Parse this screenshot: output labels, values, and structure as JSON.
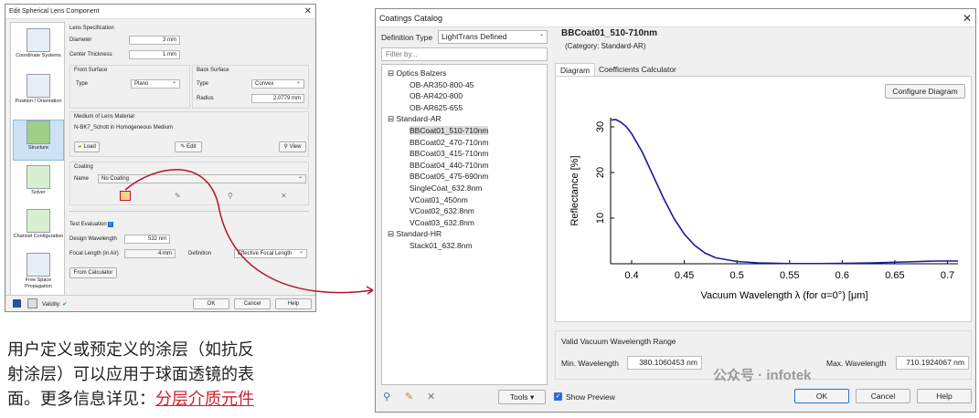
{
  "dialog": {
    "title": "Edit Spherical Lens Component",
    "sidebar": [
      "Coordinate Systems",
      "Position / Orientation",
      "Structure",
      "Solver",
      "Channel Configuration",
      "Free Space Propagation"
    ],
    "lens_spec": {
      "title": "Lens Specification",
      "diameter_label": "Diameter",
      "diameter": "3 mm",
      "thickness_label": "Center Thickness",
      "thickness": "1 mm"
    },
    "front": {
      "title": "Front Surface",
      "type_label": "Type",
      "type": "Plano"
    },
    "back": {
      "title": "Back Surface",
      "type_label": "Type",
      "type": "Convex",
      "radius_label": "Radius",
      "radius": "2.0779 mm"
    },
    "medium": {
      "title": "Medium of Lens Material",
      "value": "N-BK7_Schott in Homogeneous Medium",
      "load": "Load",
      "edit": "Edit",
      "view": "View"
    },
    "coating": {
      "title": "Coating",
      "name_label": "Name",
      "name": "No Coating"
    },
    "test": {
      "title": "Test Evaluation",
      "wl_label": "Design Wavelength",
      "wl": "532 nm",
      "fl_label": "Focal Length (in Air)",
      "fl": "4 mm",
      "def_label": "Definition",
      "def": "Effective Focal Length",
      "from_calc": "From Calculator"
    },
    "validity": "Validity:",
    "ok": "OK",
    "cancel": "Cancel",
    "help": "Help"
  },
  "caption": {
    "line1": "用户定义或预定义的涂层（如抗反",
    "line2": "射涂层）可以应用于球面透镜的表",
    "line3_prefix": "面。更多信息详见：",
    "line3_link": "分层介质元件"
  },
  "catalog": {
    "title": "Coatings Catalog",
    "def_type_label": "Definition Type",
    "def_type": "LightTrans Defined",
    "filter_placeholder": "Filter by...",
    "tree": [
      {
        "label": "Optics Balzers",
        "group": true
      },
      {
        "label": "OB-AR350-800-45"
      },
      {
        "label": "OB-AR420-800"
      },
      {
        "label": "OB-AR625-655"
      },
      {
        "label": "Standard-AR",
        "group": true
      },
      {
        "label": "BBCoat01_510-710nm",
        "selected": true
      },
      {
        "label": "BBCoat02_470-710nm"
      },
      {
        "label": "BBCoat03_415-710nm"
      },
      {
        "label": "BBCoat04_440-710nm"
      },
      {
        "label": "BBCoat05_475-690nm"
      },
      {
        "label": "SingleCoat_632.8nm"
      },
      {
        "label": "VCoat01_450nm"
      },
      {
        "label": "VCoat02_632.8nm"
      },
      {
        "label": "VCoat03_632.8nm"
      },
      {
        "label": "Standard-HR",
        "group": true
      },
      {
        "label": "Stack01_632.8nm"
      }
    ],
    "selected_name": "BBCoat01_510-710nm",
    "category": "(Category: Standard-AR)",
    "tabs": [
      "Diagram",
      "Coefficients Calculator"
    ],
    "configure": "Configure Diagram",
    "range_title": "Valid Vacuum Wavelength Range",
    "min_label": "Min. Wavelength",
    "min": "380.1060453 nm",
    "max_label": "Max. Wavelength",
    "max": "710.1924067 nm",
    "tools": "Tools",
    "show_preview": "Show Preview",
    "ok": "OK",
    "cancel": "Cancel",
    "help": "Help"
  },
  "watermark": "公众号 · infotek",
  "chart_data": {
    "type": "line",
    "xlabel": "Vacuum Wavelength λ (for α=0°) [μm]",
    "ylabel": "Reflectance [%]",
    "xlim": [
      0.38,
      0.71
    ],
    "ylim": [
      0,
      32
    ],
    "xticks": [
      "0.4",
      "0.45",
      "0.5",
      "0.55",
      "0.6",
      "0.65",
      "0.7"
    ],
    "yticks": [
      "10",
      "20",
      "30"
    ],
    "series": [
      {
        "color": "#1a1a9c",
        "x": [
          0.38,
          0.385,
          0.39,
          0.395,
          0.4,
          0.41,
          0.42,
          0.43,
          0.44,
          0.45,
          0.46,
          0.47,
          0.48,
          0.5,
          0.52,
          0.55,
          0.58,
          0.6,
          0.63,
          0.66,
          0.69,
          0.71
        ],
        "y": [
          31.5,
          31.6,
          31.0,
          30.0,
          28.5,
          24.5,
          19.5,
          14.5,
          10.0,
          6.5,
          4.0,
          2.3,
          1.3,
          0.5,
          0.2,
          0.05,
          0.05,
          0.1,
          0.2,
          0.4,
          0.6,
          0.6
        ]
      }
    ]
  }
}
